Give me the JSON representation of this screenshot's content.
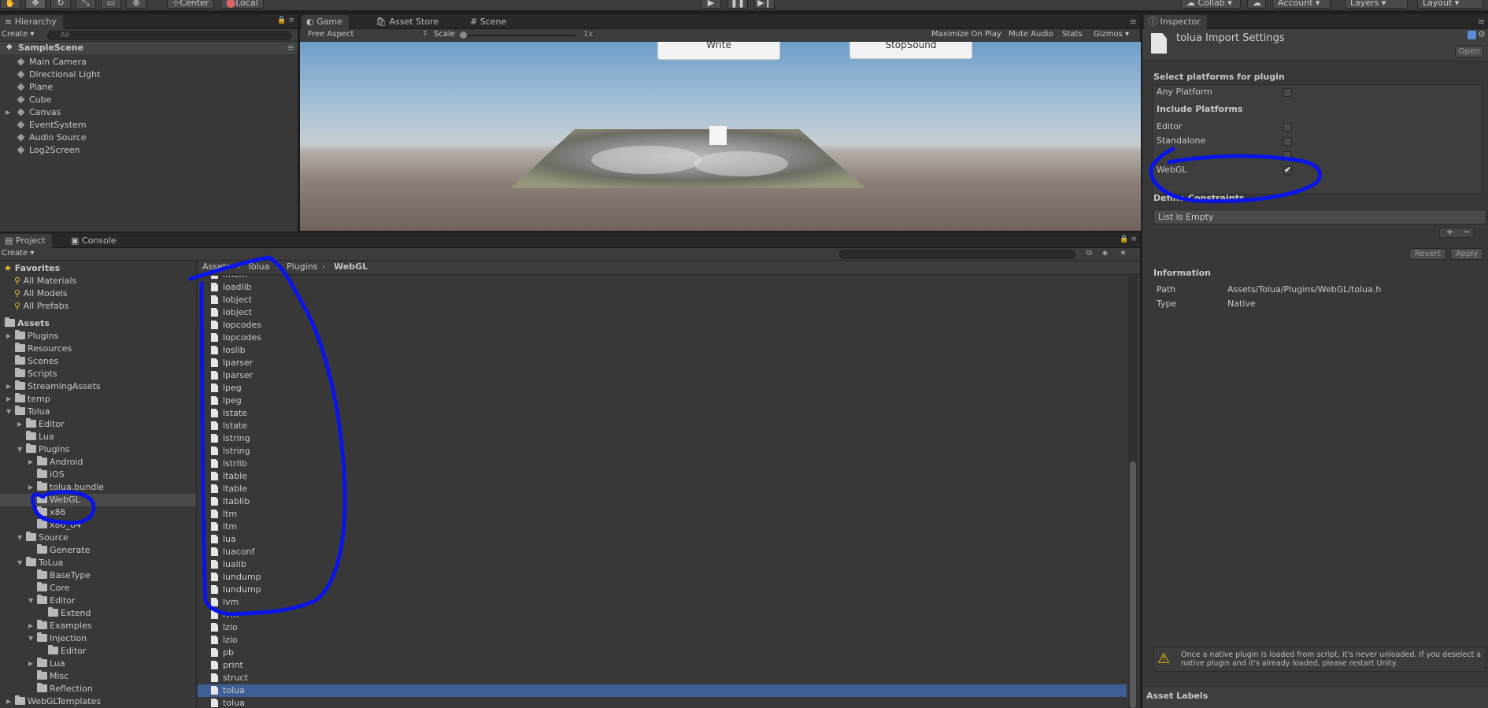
{
  "toolbar": {
    "pivot": "Center",
    "space": "Local",
    "collab": "Collab",
    "account": "Account",
    "layers": "Layers",
    "layout": "Layout"
  },
  "hierarchy": {
    "tab": "Hierarchy",
    "create": "Create",
    "search_placeholder": "All",
    "scene": "SampleScene",
    "items": [
      "Main Camera",
      "Directional Light",
      "Plane",
      "Cube",
      "Canvas",
      "EventSystem",
      "Audio Source",
      "Log2Screen"
    ]
  },
  "gameview": {
    "tabs": [
      "Game",
      "Asset Store",
      "Scene"
    ],
    "aspect": "Free Aspect",
    "scale_label": "Scale",
    "scale_value": "1x",
    "maximize": "Maximize On Play",
    "mute": "Mute Audio",
    "stats": "Stats",
    "gizmos": "Gizmos",
    "buttons": [
      "Write",
      "StopSound"
    ]
  },
  "project": {
    "tabs": [
      "Project",
      "Console"
    ],
    "create": "Create",
    "favorites_label": "Favorites",
    "favorites": [
      "All Materials",
      "All Models",
      "All Prefabs"
    ],
    "assets_label": "Assets",
    "tree": [
      {
        "label": "Plugins",
        "arrow": "▶"
      },
      {
        "label": "Resources",
        "arrow": ""
      },
      {
        "label": "Scenes",
        "arrow": ""
      },
      {
        "label": "Scripts",
        "arrow": ""
      },
      {
        "label": "StreamingAssets",
        "arrow": "▶"
      },
      {
        "label": "temp",
        "arrow": "▶"
      },
      {
        "label": "Tolua",
        "arrow": "▼"
      },
      {
        "label": "Editor",
        "arrow": "▶"
      },
      {
        "label": "Lua",
        "arrow": ""
      },
      {
        "label": "Plugins",
        "arrow": "▼"
      },
      {
        "label": "Android",
        "arrow": "▶"
      },
      {
        "label": "iOS",
        "arrow": ""
      },
      {
        "label": "tolua.bundle",
        "arrow": "▶"
      },
      {
        "label": "WebGL",
        "arrow": ""
      },
      {
        "label": "x86",
        "arrow": ""
      },
      {
        "label": "x86_64",
        "arrow": ""
      },
      {
        "label": "Source",
        "arrow": "▼"
      },
      {
        "label": "Generate",
        "arrow": ""
      },
      {
        "label": "ToLua",
        "arrow": "▼"
      },
      {
        "label": "BaseType",
        "arrow": ""
      },
      {
        "label": "Core",
        "arrow": ""
      },
      {
        "label": "Editor",
        "arrow": "▼"
      },
      {
        "label": "Extend",
        "arrow": ""
      },
      {
        "label": "Examples",
        "arrow": "▶"
      },
      {
        "label": "Injection",
        "arrow": "▼"
      },
      {
        "label": "Editor",
        "arrow": ""
      },
      {
        "label": "Lua",
        "arrow": "▶"
      },
      {
        "label": "Misc",
        "arrow": ""
      },
      {
        "label": "Reflection",
        "arrow": ""
      },
      {
        "label": "WebGLTemplates",
        "arrow": "▶"
      }
    ],
    "breadcrumb": [
      "Assets",
      "Tolua",
      "Plugins",
      "WebGL"
    ],
    "files": [
      "lmem",
      "loadlib",
      "lobject",
      "lobject",
      "lopcodes",
      "lopcodes",
      "loslib",
      "lparser",
      "lparser",
      "lpeg",
      "lpeg",
      "lstate",
      "lstate",
      "lstring",
      "lstring",
      "lstrlib",
      "ltable",
      "ltable",
      "ltablib",
      "ltm",
      "ltm",
      "lua",
      "luaconf",
      "lualib",
      "lundump",
      "lundump",
      "lvm",
      "lvm",
      "lzio",
      "lzio",
      "pb",
      "print",
      "struct",
      "tolua",
      "tolua"
    ],
    "selected_file_index": 33
  },
  "inspector": {
    "tab": "Inspector",
    "title": "tolua Import Settings",
    "open": "Open",
    "select_platforms": "Select platforms for plugin",
    "any_platform": "Any Platform",
    "include_platforms": "Include Platforms",
    "platforms": [
      {
        "name": "Editor",
        "checked": false
      },
      {
        "name": "Standalone",
        "checked": false
      },
      {
        "name": "WebGL",
        "checked": true
      }
    ],
    "define_constraints": "Define Constraints",
    "list_empty": "List is Empty",
    "revert": "Revert",
    "apply": "Apply",
    "information": "Information",
    "path_label": "Path",
    "path_value": "Assets/Tolua/Plugins/WebGL/tolua.h",
    "type_label": "Type",
    "type_value": "Native",
    "warning": "Once a native plugin is loaded from script, it's never unloaded. If you deselect a native plugin and it's already loaded, please restart Unity.",
    "asset_labels": "Asset Labels"
  },
  "colors": {
    "annotation": "#0a14e6",
    "selection": "#3d5f96",
    "panel": "#383838"
  }
}
